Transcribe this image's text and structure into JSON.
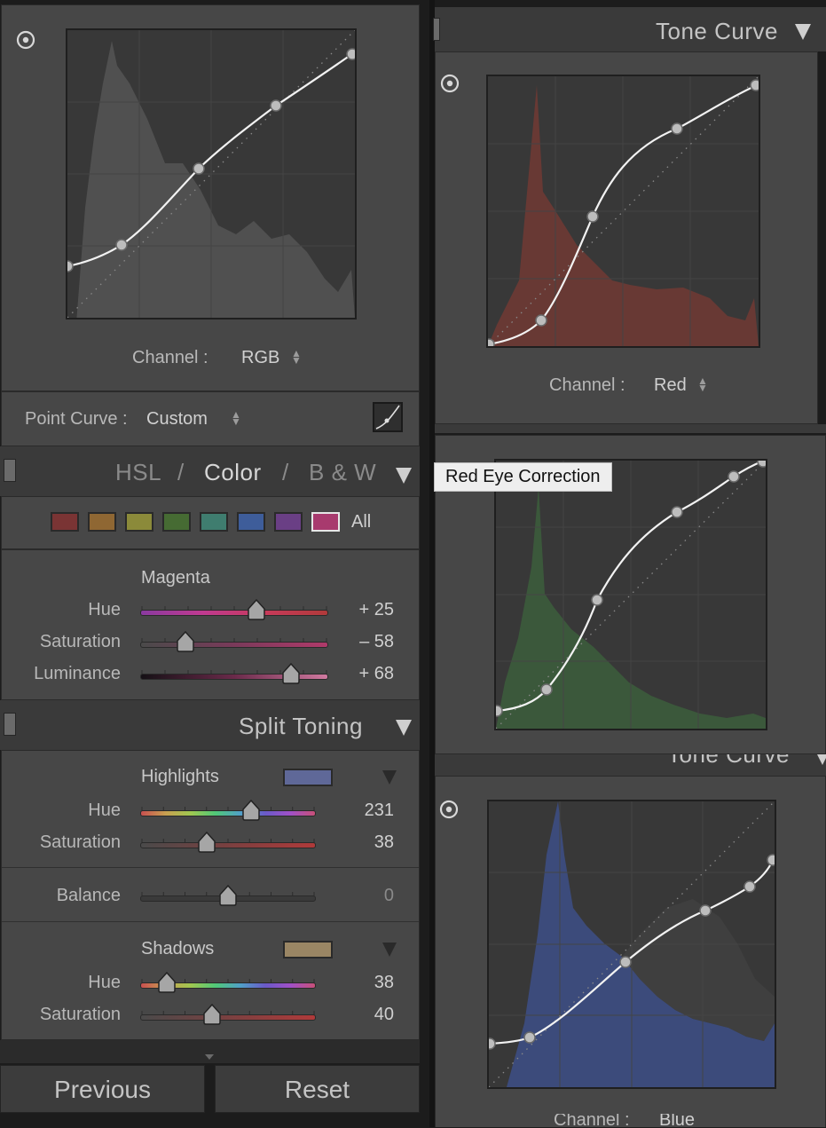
{
  "left": {
    "tone_curve": {
      "channel_label": "Channel :",
      "channel_value": "RGB",
      "point_curve_label": "Point Curve :",
      "point_curve_value": "Custom"
    },
    "hsl": {
      "tabs": [
        "HSL",
        "/",
        "Color",
        "/",
        "B & W"
      ],
      "active_tab": "Color",
      "swatch_colors": [
        "#7a3434",
        "#8f6733",
        "#8b8a3a",
        "#466b33",
        "#3f7d6f",
        "#3e5d9a",
        "#6a3f85",
        "#a83a6e"
      ],
      "all_label": "All",
      "selected_color_name": "Magenta",
      "rows": [
        {
          "label": "Hue",
          "value": "+ 25",
          "position": 0.62
        },
        {
          "label": "Saturation",
          "value": "– 58",
          "position": 0.24
        },
        {
          "label": "Luminance",
          "value": "+ 68",
          "position": 0.8
        }
      ]
    },
    "split_toning": {
      "title": "Split Toning",
      "highlights": {
        "label": "Highlights",
        "swatch_color": "#5f6898",
        "hue": {
          "label": "Hue",
          "value": "231",
          "position": 0.63
        },
        "saturation": {
          "label": "Saturation",
          "value": "38",
          "position": 0.38
        }
      },
      "balance": {
        "label": "Balance",
        "value": "0",
        "position": 0.5
      },
      "shadows": {
        "label": "Shadows",
        "swatch_color": "#9a8664",
        "hue": {
          "label": "Hue",
          "value": "38",
          "position": 0.15
        },
        "saturation": {
          "label": "Saturation",
          "value": "40",
          "position": 0.41
        }
      }
    },
    "buttons": {
      "previous": "Previous",
      "reset": "Reset"
    }
  },
  "right": {
    "top_header": "Tone Curve",
    "red_panel": {
      "channel_label": "Channel :",
      "channel_value": "Red"
    },
    "tooltip": "Red Eye Correction",
    "blue_header": "Tone Curve",
    "blue_panel": {
      "channel_label": "Channel :",
      "channel_value": "Blue"
    }
  },
  "colors": {
    "panel_bg": "#474747",
    "header_bg": "#3a3a3a",
    "graph_bg": "#383838",
    "red_histogram": "#6e3a34",
    "green_histogram": "#3b5a3b",
    "blue_histogram": "#3c4c7e",
    "gray_histogram": "#505050"
  }
}
